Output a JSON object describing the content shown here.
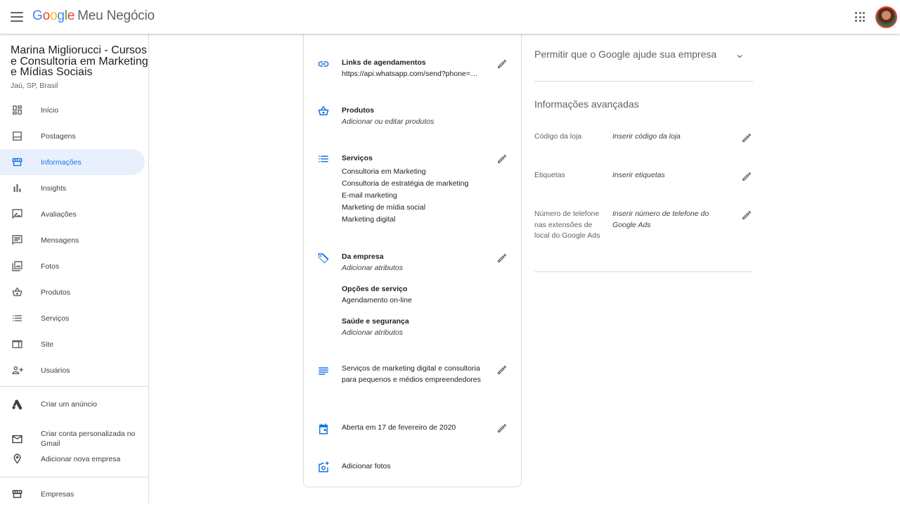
{
  "app": {
    "logo_letters": [
      "G",
      "o",
      "o",
      "g",
      "l",
      "e"
    ],
    "product": "Meu Negócio"
  },
  "business": {
    "name": "Marina Migliorucci - Cursos e Consultoria em Marketing e Mídias Sociais",
    "location": "Jaú, SP, Brasil"
  },
  "sidebar": {
    "items": [
      {
        "label": "Início",
        "icon": "dashboard-icon"
      },
      {
        "label": "Postagens",
        "icon": "posts-icon"
      },
      {
        "label": "Informações",
        "icon": "storefront-icon",
        "active": true
      },
      {
        "label": "Insights",
        "icon": "bar-chart-icon"
      },
      {
        "label": "Avaliações",
        "icon": "rate-review-icon"
      },
      {
        "label": "Mensagens",
        "icon": "message-icon"
      },
      {
        "label": "Fotos",
        "icon": "photo-library-icon"
      },
      {
        "label": "Produtos",
        "icon": "basket-icon"
      },
      {
        "label": "Serviços",
        "icon": "list-icon"
      },
      {
        "label": "Site",
        "icon": "web-icon"
      },
      {
        "label": "Usuários",
        "icon": "person-add-icon"
      }
    ],
    "extra": [
      {
        "label": "Criar um anúncio",
        "icon": "google-ads-icon"
      },
      {
        "label": "Criar conta personalizada no Gmail",
        "icon": "mail-icon"
      },
      {
        "label": "Adicionar nova empresa",
        "icon": "add-location-icon"
      }
    ],
    "bottom": [
      {
        "label": "Empresas",
        "icon": "store-icon"
      }
    ]
  },
  "info": {
    "booking": {
      "title": "Links de agendamentos",
      "value": "https://api.whatsapp.com/send?phone=…"
    },
    "products": {
      "title": "Produtos",
      "value": "Adicionar ou editar produtos"
    },
    "services": {
      "title": "Serviços",
      "category": "Consultoria em Marketing",
      "items": [
        "Consultoria de estratégia de marketing",
        "E-mail marketing",
        "Marketing de mídia social",
        "Marketing digital"
      ]
    },
    "attributes": {
      "title": "Da empresa",
      "value": "Adicionar atributos",
      "service_options_title": "Opções de serviço",
      "service_options_value": "Agendamento on-line",
      "health_title": "Saúde e segurança",
      "health_value": "Adicionar atributos"
    },
    "description": "Serviços de marketing digital e consultoria para pequenos e médios empreendedores",
    "opening": "Aberta em 17 de fevereiro de 2020",
    "photos": "Adicionar fotos"
  },
  "right_panel": {
    "allow_google": "Permitir que o Google ajude sua empresa",
    "advanced_title": "Informações avançadas",
    "fields": [
      {
        "label": "Código da loja",
        "value": "Inserir código da loja"
      },
      {
        "label": "Etiquetas",
        "value": "Inserir etiquetas"
      },
      {
        "label": "Número de telefone nas extensões de local do Google Ads",
        "value": "Inserir número de telefone do Google Ads"
      }
    ]
  },
  "colors": {
    "accent": "#1a73e8",
    "active_bg": "#e8f0fe",
    "icon": "#5f6368"
  }
}
